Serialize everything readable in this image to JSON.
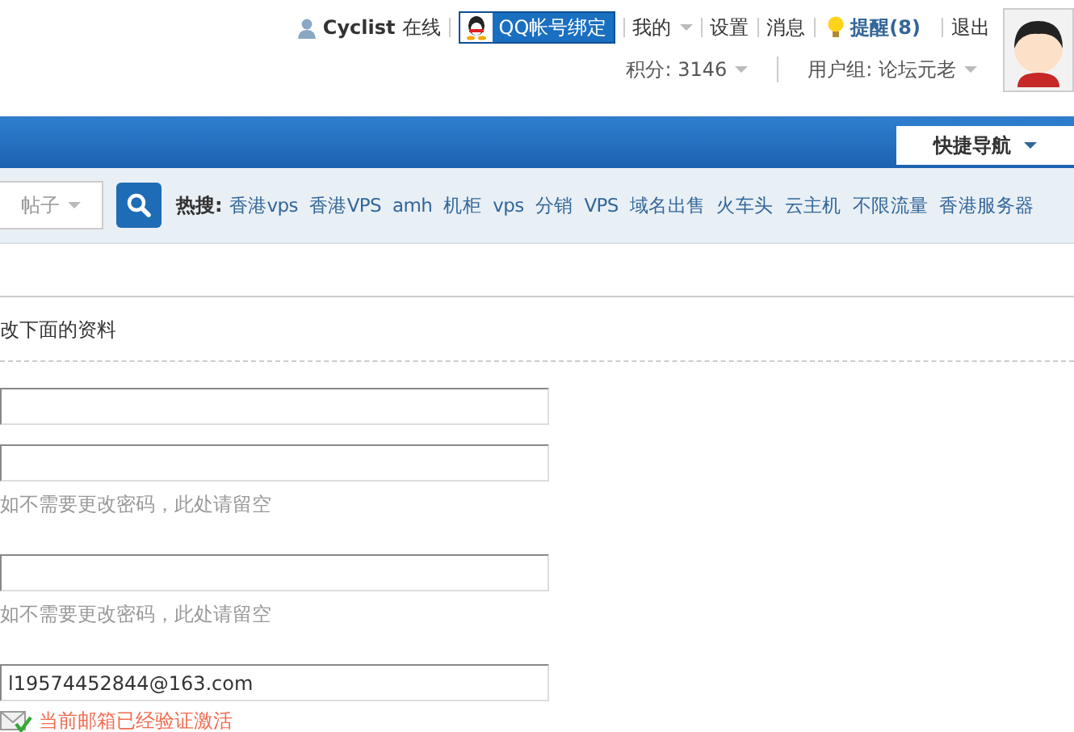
{
  "user_bar": {
    "username": "Cyclist",
    "status": "在线",
    "qq_button": "QQ帐号绑定",
    "menu": [
      {
        "label": "我的",
        "dropdown": true,
        "kind": "link"
      },
      {
        "label": "设置",
        "dropdown": false,
        "kind": "link"
      },
      {
        "label": "消息",
        "dropdown": false,
        "kind": "link"
      },
      {
        "label": "提醒(8)",
        "dropdown": false,
        "kind": "alert"
      },
      {
        "label": "退出",
        "dropdown": false,
        "kind": "link"
      }
    ],
    "stats": [
      {
        "label": "积分: 3146",
        "dropdown": true
      },
      {
        "label": "用户组: 论坛元老",
        "dropdown": true
      }
    ]
  },
  "nav": {
    "quick_nav": "快捷导航"
  },
  "search": {
    "type_select": "帖子",
    "hot_label": "热搜:",
    "hot_words": [
      "香港vps",
      "香港VPS",
      "amh",
      "机柜",
      "vps",
      "分销",
      "VPS",
      "域名出售",
      "火车头",
      "云主机",
      "不限流量",
      "香港服务器"
    ]
  },
  "form": {
    "intro": "改下面的资料",
    "fields": [
      {
        "kind": "text"
      },
      {
        "kind": "password",
        "hint": "如不需要更改密码，此处请留空"
      },
      {
        "kind": "password",
        "hint": "如不需要更改密码，此处请留空"
      },
      {
        "kind": "text",
        "value": "l19574452844@163.com"
      }
    ],
    "email_status": "当前邮箱已经验证激活"
  }
}
